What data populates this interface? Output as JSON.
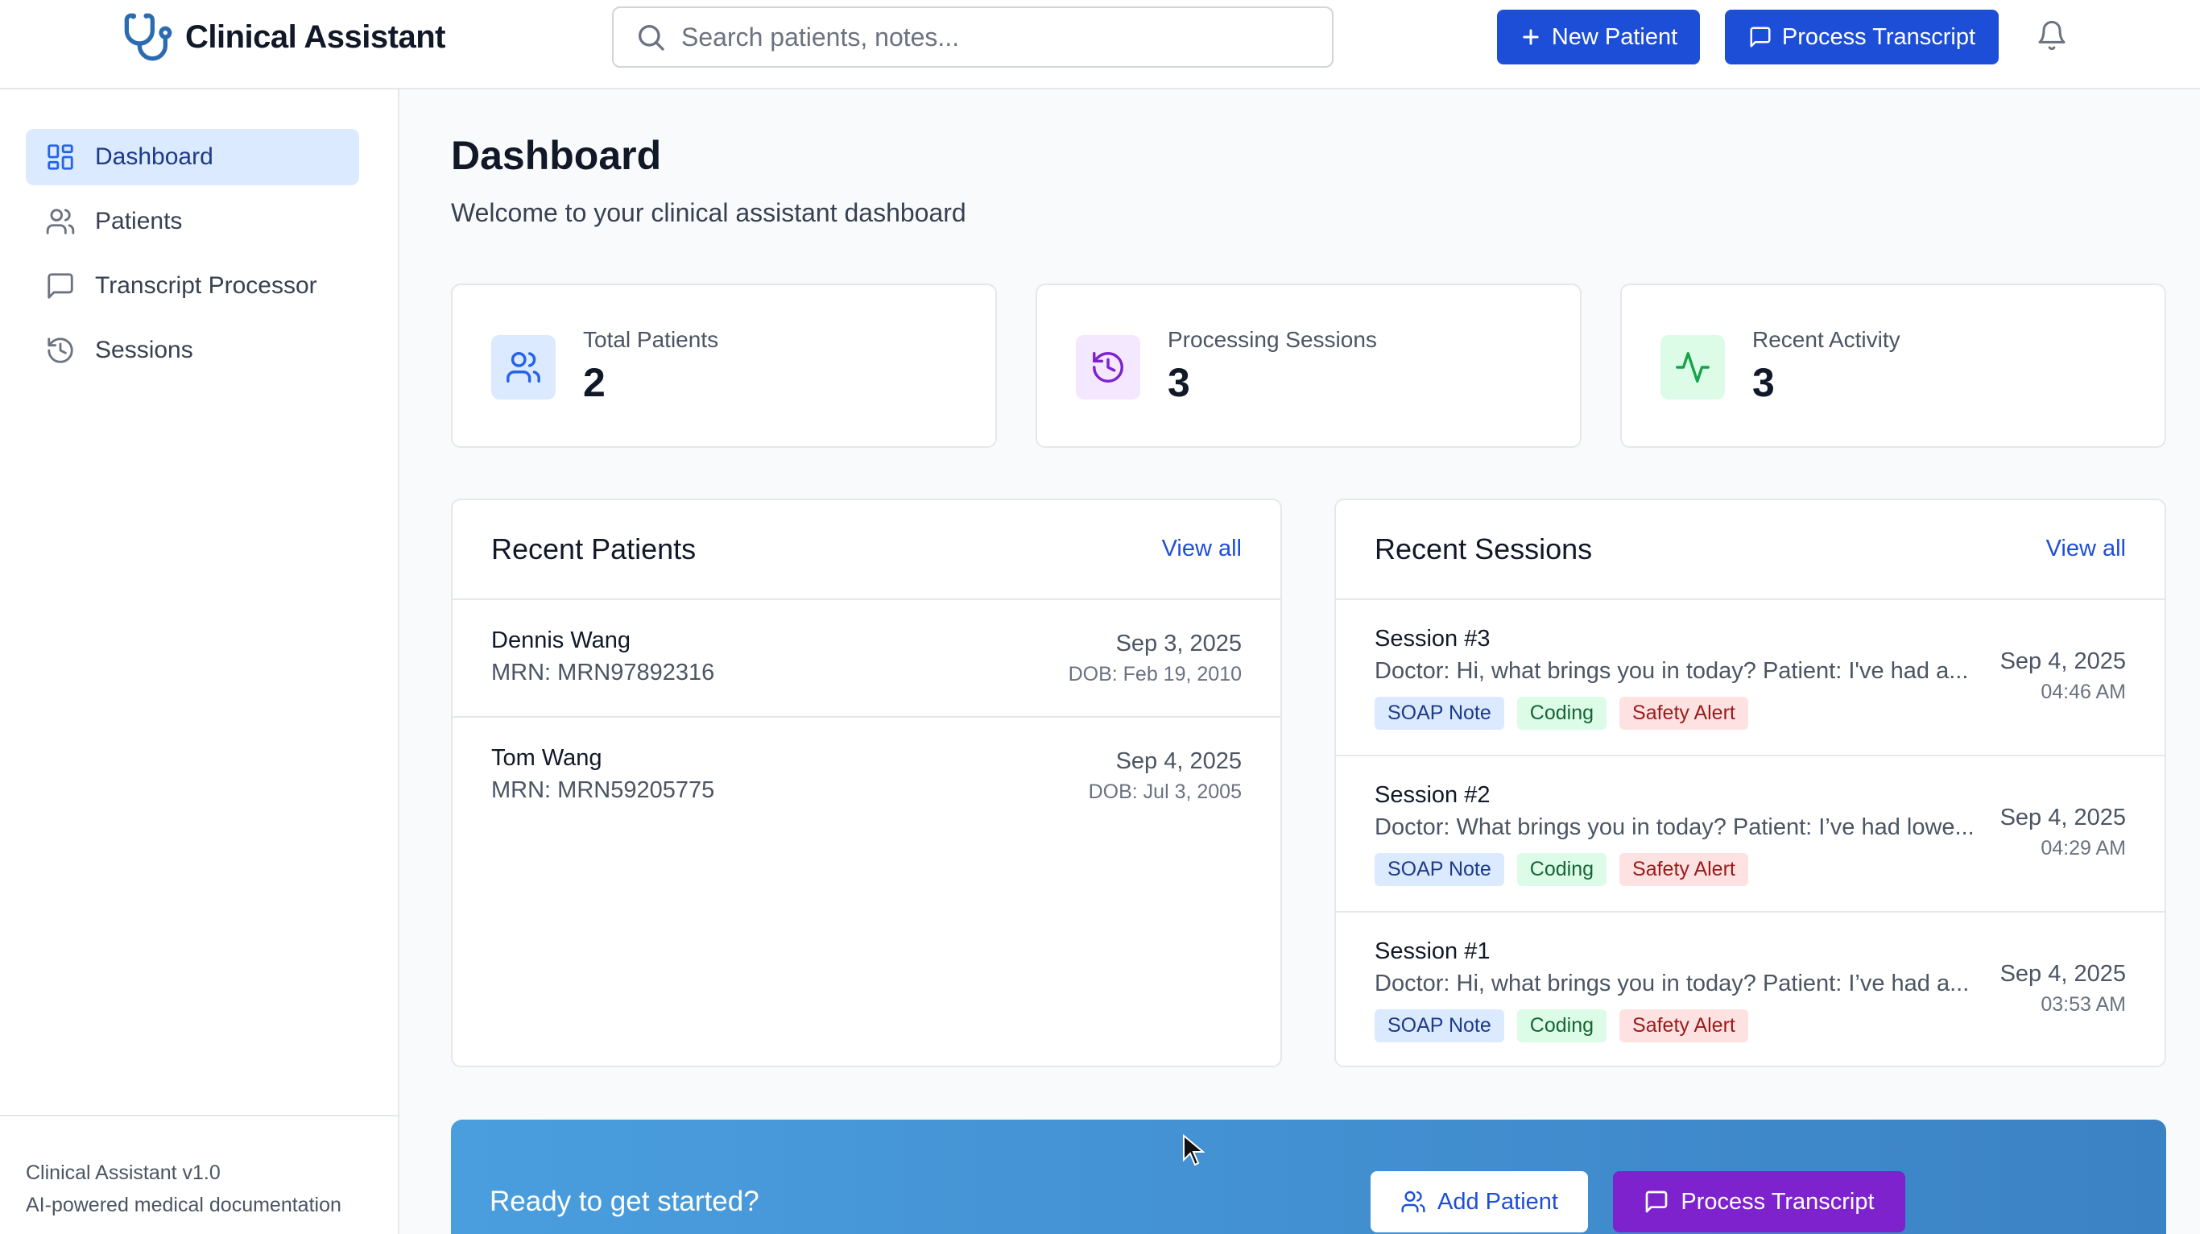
{
  "header": {
    "app_title": "Clinical Assistant",
    "search_placeholder": "Search patients, notes...",
    "new_patient_label": "New Patient",
    "process_transcript_label": "Process Transcript"
  },
  "sidebar": {
    "items": [
      {
        "label": "Dashboard",
        "icon": "dashboard-icon",
        "active": true
      },
      {
        "label": "Patients",
        "icon": "users-icon",
        "active": false
      },
      {
        "label": "Transcript Processor",
        "icon": "message-icon",
        "active": false
      },
      {
        "label": "Sessions",
        "icon": "history-icon",
        "active": false
      }
    ],
    "footer": {
      "version": "Clinical Assistant v1.0",
      "tagline": "AI-powered medical documentation"
    }
  },
  "main": {
    "title": "Dashboard",
    "subtitle": "Welcome to your clinical assistant dashboard",
    "stats": [
      {
        "label": "Total Patients",
        "value": "2",
        "icon": "users-icon"
      },
      {
        "label": "Processing Sessions",
        "value": "3",
        "icon": "history-icon"
      },
      {
        "label": "Recent Activity",
        "value": "3",
        "icon": "activity-icon"
      }
    ],
    "recent_patients": {
      "title": "Recent Patients",
      "view_all": "View all",
      "rows": [
        {
          "name": "Dennis Wang",
          "mrn": "MRN: MRN97892316",
          "date": "Sep 3, 2025",
          "dob": "DOB: Feb 19, 2010"
        },
        {
          "name": "Tom Wang",
          "mrn": "MRN: MRN59205775",
          "date": "Sep 4, 2025",
          "dob": "DOB: Jul 3, 2005"
        }
      ]
    },
    "recent_sessions": {
      "title": "Recent Sessions",
      "view_all": "View all",
      "tags": [
        "SOAP Note",
        "Coding",
        "Safety Alert"
      ],
      "rows": [
        {
          "title": "Session #3",
          "text": "Doctor: Hi, what brings you in today? Patient: I've had a...",
          "date": "Sep 4, 2025",
          "time": "04:46 AM"
        },
        {
          "title": "Session #2",
          "text": "Doctor: What brings you in today? Patient: I’ve had lowe...",
          "date": "Sep 4, 2025",
          "time": "04:29 AM"
        },
        {
          "title": "Session #1",
          "text": "Doctor: Hi, what brings you in today? Patient: I’ve had a...",
          "date": "Sep 4, 2025",
          "time": "03:53 AM"
        }
      ]
    },
    "cta": {
      "text": "Ready to get started?",
      "add_patient_label": "Add Patient",
      "process_transcript_label": "Process Transcript"
    }
  },
  "colors": {
    "primary": "#1d4ed8",
    "active_nav_bg": "#dbeafe",
    "purple": "#7e22ce"
  }
}
